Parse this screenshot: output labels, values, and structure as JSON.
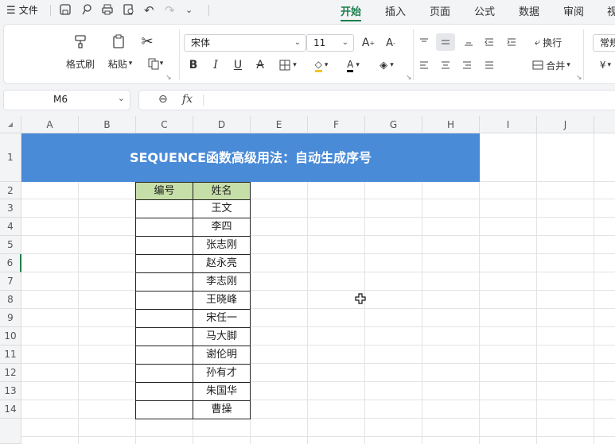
{
  "menu": {
    "icon": "hamburger-icon",
    "label": "文件"
  },
  "tabs": [
    {
      "label": "开始",
      "active": true
    },
    {
      "label": "插入",
      "active": false
    },
    {
      "label": "页面",
      "active": false
    },
    {
      "label": "公式",
      "active": false
    },
    {
      "label": "数据",
      "active": false
    },
    {
      "label": "审阅",
      "active": false
    },
    {
      "label": "视",
      "active": false
    }
  ],
  "ribbon": {
    "format_painter": "格式刷",
    "paste": "粘贴",
    "font_name": "宋体",
    "font_size": "11",
    "wrap": "换行",
    "merge": "合并",
    "number_format": "常规",
    "currency_symbol": "¥"
  },
  "formula_bar": {
    "name_box": "M6",
    "fx": "fx",
    "formula": ""
  },
  "columns": [
    "A",
    "B",
    "C",
    "D",
    "E",
    "F",
    "G",
    "H",
    "I",
    "J"
  ],
  "rows": [
    "1",
    "2",
    "3",
    "4",
    "5",
    "6",
    "7",
    "8",
    "9",
    "10",
    "11",
    "12",
    "13",
    "14",
    ""
  ],
  "sheet": {
    "title": "SEQUENCE函数高级用法：自动生成序号",
    "headers": {
      "c": "编号",
      "d": "姓名"
    },
    "names": [
      "王文",
      "李四",
      "张志刚",
      "赵永亮",
      "李志刚",
      "王晓峰",
      "宋任一",
      "马大脚",
      "谢伦明",
      "孙有才",
      "朱国华",
      "曹操"
    ]
  },
  "colors": {
    "accent": "#1a7f4b",
    "banner": "#4a8bd8",
    "header_fill": "#c6dfa8"
  }
}
